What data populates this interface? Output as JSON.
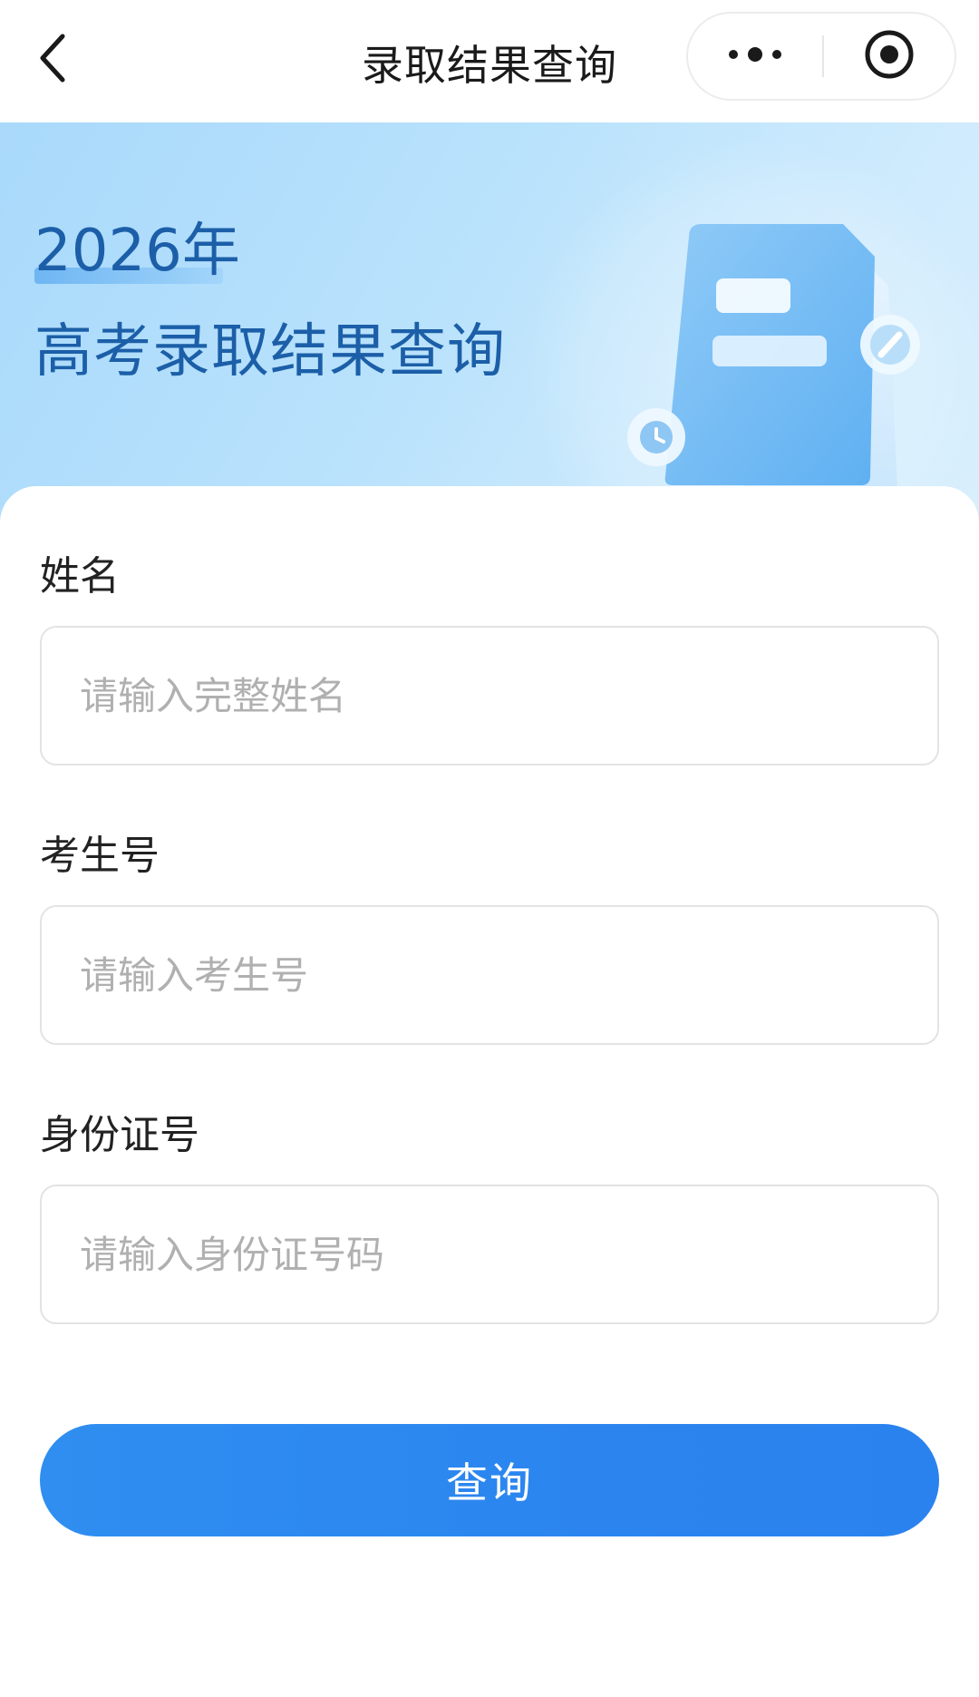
{
  "navbar": {
    "title": "录取结果查询",
    "back_icon": "chevron-left-icon",
    "more_icon": "more-dots-icon",
    "close_icon": "target-circle-icon"
  },
  "banner": {
    "year": "2026年",
    "title": "高考录取结果查询",
    "illustration": "document-clock-pencil-illustration"
  },
  "form": {
    "name": {
      "label": "姓名",
      "placeholder": "请输入完整姓名",
      "value": ""
    },
    "exam_number": {
      "label": "考生号",
      "placeholder": "请输入考生号",
      "value": ""
    },
    "id_number": {
      "label": "身份证号",
      "placeholder": "请输入身份证号码",
      "value": ""
    },
    "submit_label": "查询"
  },
  "colors": {
    "accent": "#2c86ef",
    "banner_title": "#1c5fa8",
    "banner_bg": "#b9e2fc",
    "placeholder": "#b0b0b0",
    "border": "#e3e3e3"
  }
}
